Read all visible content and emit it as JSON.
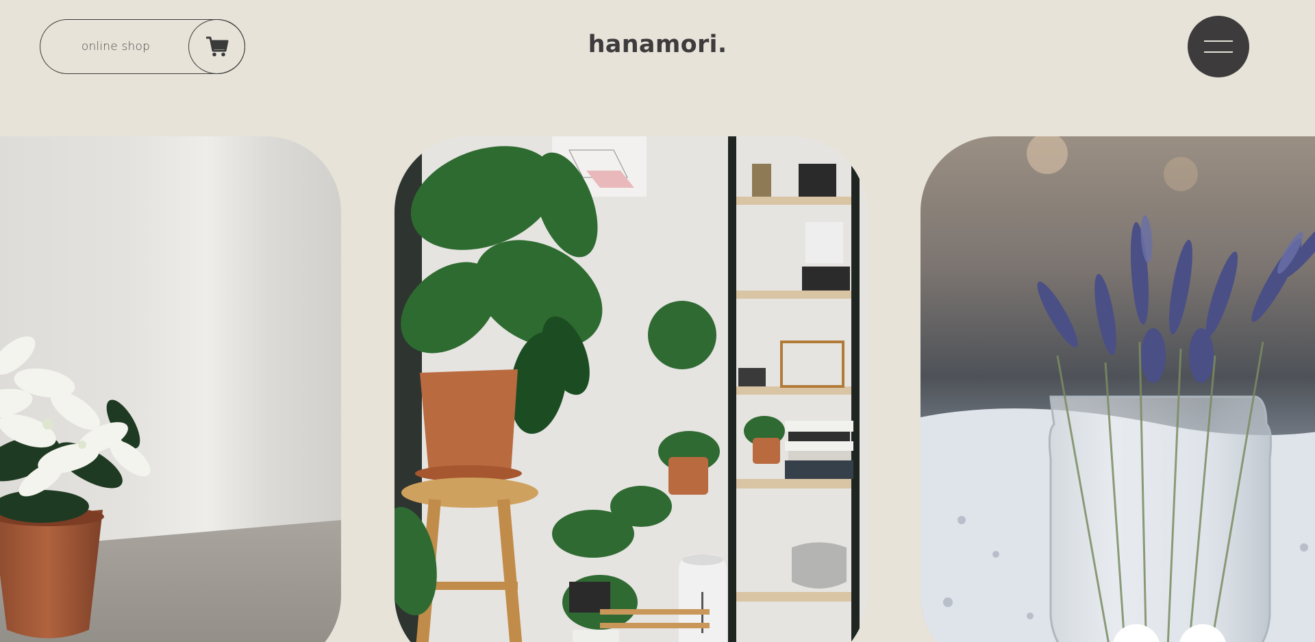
{
  "header": {
    "shop_label": "online shop",
    "cart_icon": "shopping-cart-icon",
    "logo": "hanamori.",
    "menu_icon": "hamburger-menu-icon"
  },
  "gallery": {
    "slides": [
      {
        "subject": "white-poinsettia-in-terracotta-pot"
      },
      {
        "subject": "indoor-plants-with-shelf-and-stool"
      },
      {
        "subject": "lavender-in-glass-jar"
      }
    ]
  },
  "colors": {
    "background": "#e7e3d9",
    "dark": "#3d3b3c",
    "menu_line": "#e7e3d9"
  }
}
